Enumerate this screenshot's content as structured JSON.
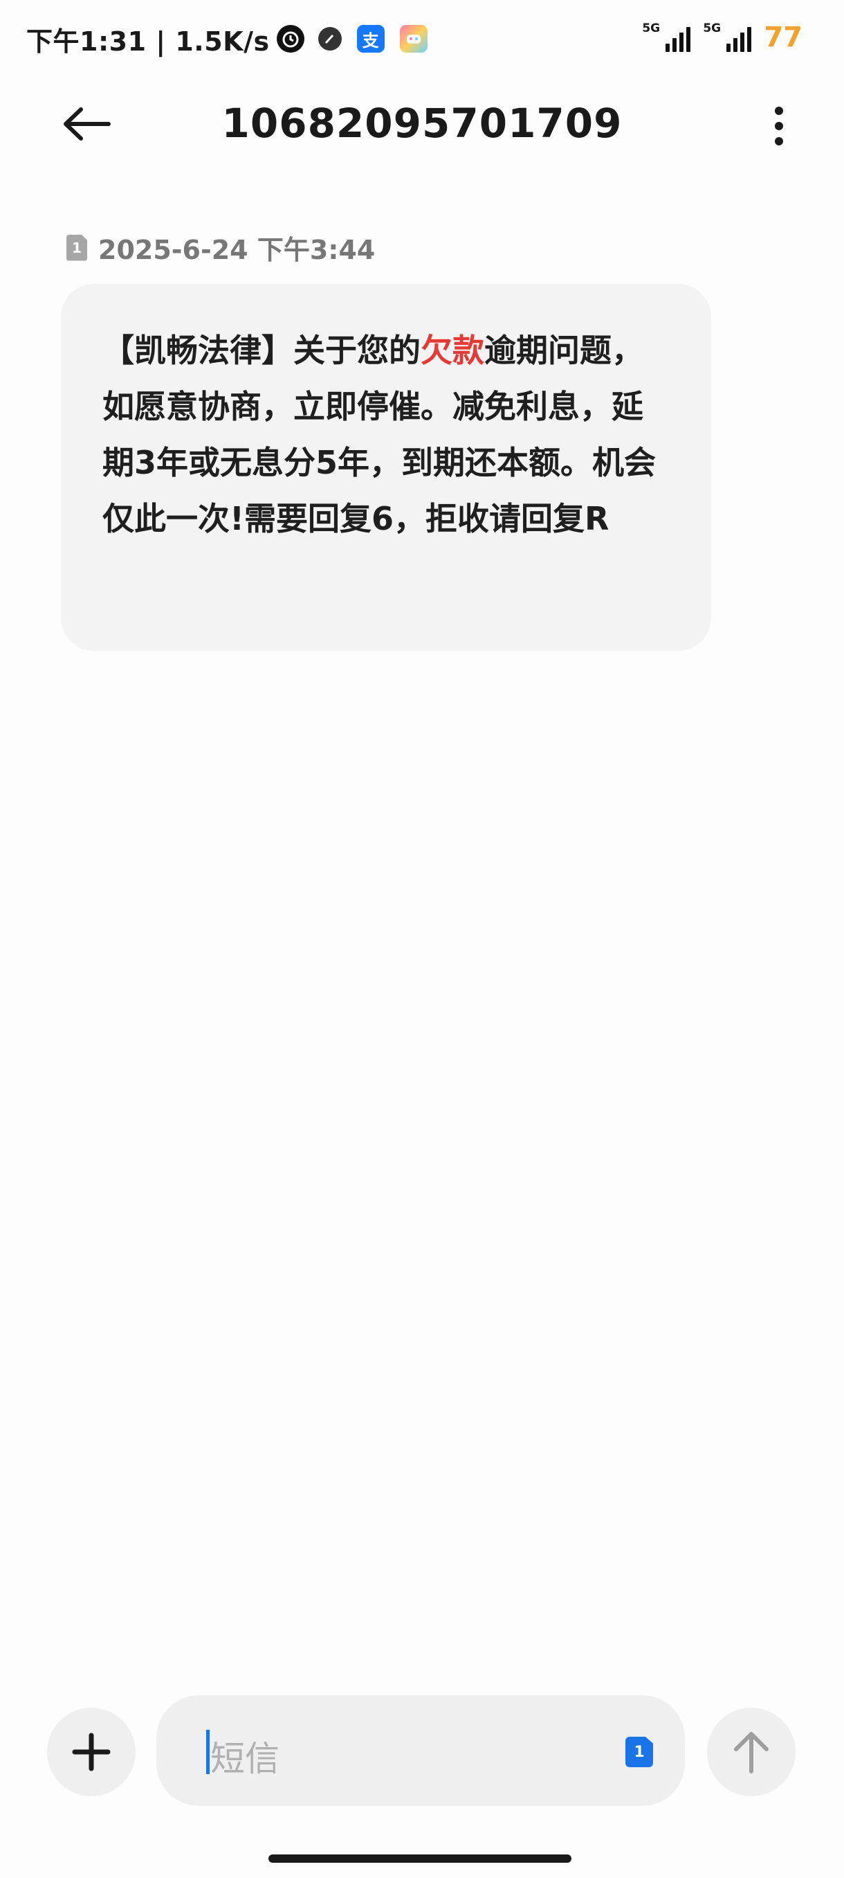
{
  "status_bar": {
    "time": "下午1:31 | 1.5K/s",
    "alipay_glyph": "支",
    "network_1": "5G",
    "network_2": "5G",
    "battery": "77",
    "accent": "#f2a22c"
  },
  "header": {
    "title": "10682095701709"
  },
  "message": {
    "sim_slot": "1",
    "timestamp": "2025-6-24 下午3:44",
    "text_before": "【凯畅法律】关于您的",
    "text_highlight": "欠款",
    "text_after": "逾期问题，如愿意协商，立即停催。减免利息，延期3年或无息分5年，到期还本额。机会仅此一次!需要回复6，拒收请回复R",
    "highlight_color": "#e53935"
  },
  "composer": {
    "placeholder": "短信",
    "sim_slot": "1",
    "accent": "#1a73e8"
  }
}
